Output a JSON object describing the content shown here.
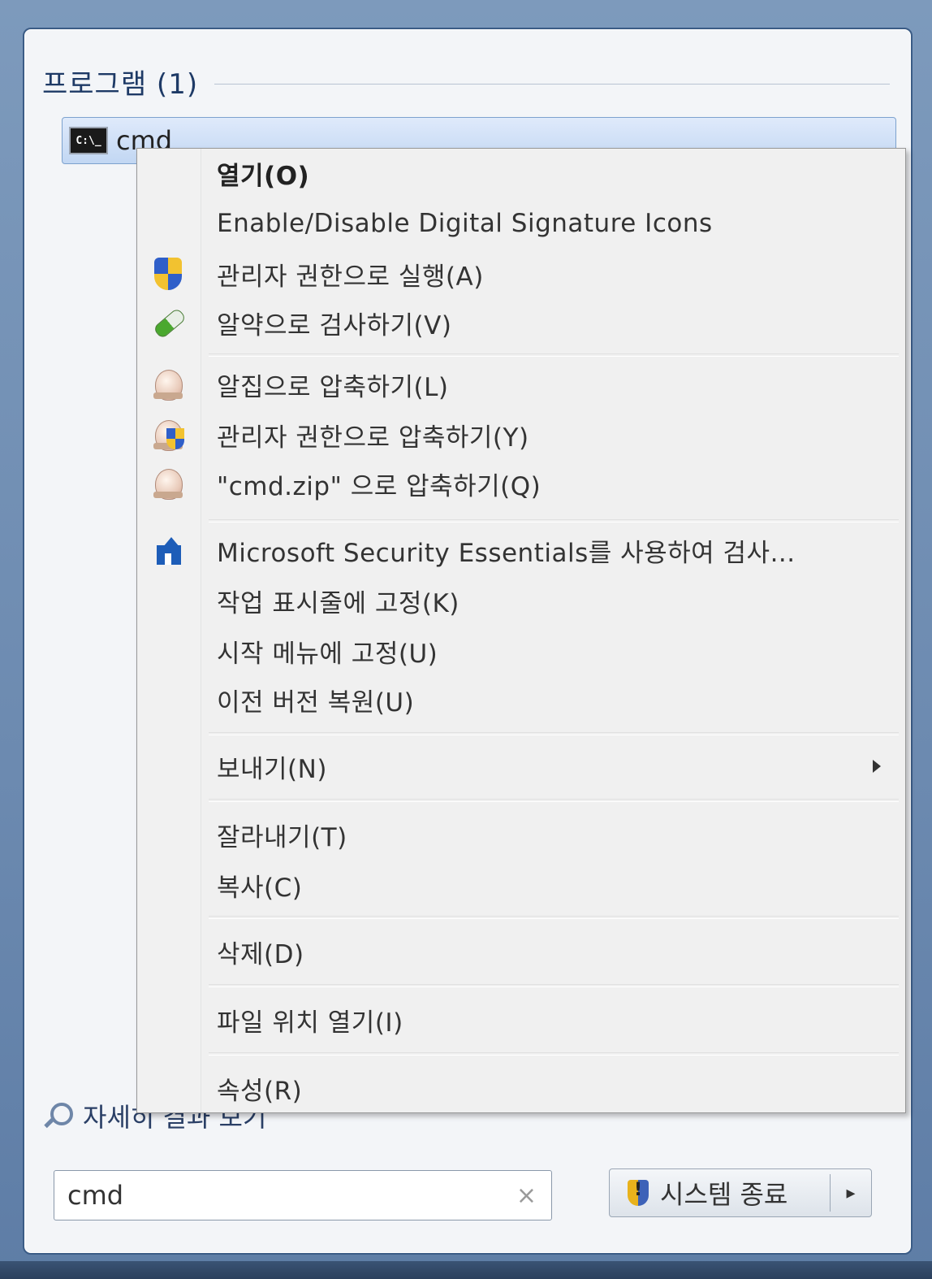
{
  "start_menu": {
    "section_title": "프로그램 (1)",
    "result_item": {
      "icon_text": "C:\\_",
      "label": "cmd"
    },
    "search_more": "자세히 결과 보기",
    "search_value": "cmd",
    "clear_glyph": "×",
    "shutdown_label": "시스템 종료",
    "shutdown_arrow": "▸"
  },
  "context_menu": {
    "items": [
      {
        "label": "열기(O)",
        "icon": "none",
        "bold": true
      },
      {
        "label": "Enable/Disable Digital Signature Icons",
        "icon": "none"
      },
      {
        "label": "관리자 권한으로 실행(A)",
        "icon": "uac-shield-icon"
      },
      {
        "label": "알약으로 검사하기(V)",
        "icon": "alyac-pill-icon"
      },
      {
        "label": "알집으로 압축하기(L)",
        "icon": "alzip-icon"
      },
      {
        "label": "관리자 권한으로 압축하기(Y)",
        "icon": "alzip-admin-icon"
      },
      {
        "label": "\"cmd.zip\" 으로 압축하기(Q)",
        "icon": "alzip-icon"
      },
      {
        "label": "Microsoft Security Essentials를 사용하여 검사...",
        "icon": "mse-icon"
      },
      {
        "label": "작업 표시줄에 고정(K)",
        "icon": "none"
      },
      {
        "label": "시작 메뉴에 고정(U)",
        "icon": "none"
      },
      {
        "label": "이전 버전 복원(U)",
        "icon": "none"
      },
      {
        "label": "보내기(N)",
        "icon": "none",
        "submenu": true
      },
      {
        "label": "잘라내기(T)",
        "icon": "none"
      },
      {
        "label": "복사(C)",
        "icon": "none"
      },
      {
        "label": "삭제(D)",
        "icon": "none"
      },
      {
        "label": "파일 위치 열기(I)",
        "icon": "none"
      },
      {
        "label": "속성(R)",
        "icon": "none"
      }
    ]
  },
  "colors": {
    "menu_background": "#f0f0f0",
    "highlight_blue": "#c2d7f3",
    "uac_blue": "#2f5fc9",
    "uac_yellow": "#f2c230"
  }
}
